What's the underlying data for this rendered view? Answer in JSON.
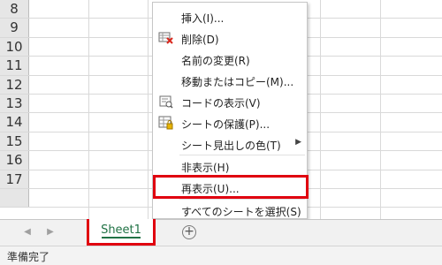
{
  "rows": [
    "8",
    "9",
    "10",
    "11",
    "12",
    "13",
    "14",
    "15",
    "16",
    "17"
  ],
  "context_menu": {
    "insert": "挿入(I)...",
    "delete": "削除(D)",
    "rename": "名前の変更(R)",
    "move_copy": "移動またはコピー(M)...",
    "view_code": "コードの表示(V)",
    "protect_sheet": "シートの保護(P)...",
    "tab_color": "シート見出しの色(T)",
    "hide": "非表示(H)",
    "unhide": "再表示(U)...",
    "select_all_sheets": "すべてのシートを選択(S)"
  },
  "sheet_tab": {
    "label": "Sheet1"
  },
  "add_sheet_symbol": "+",
  "status": {
    "text": "準備完了"
  },
  "colors": {
    "highlight": "#e0000f",
    "excel_green": "#217346"
  }
}
